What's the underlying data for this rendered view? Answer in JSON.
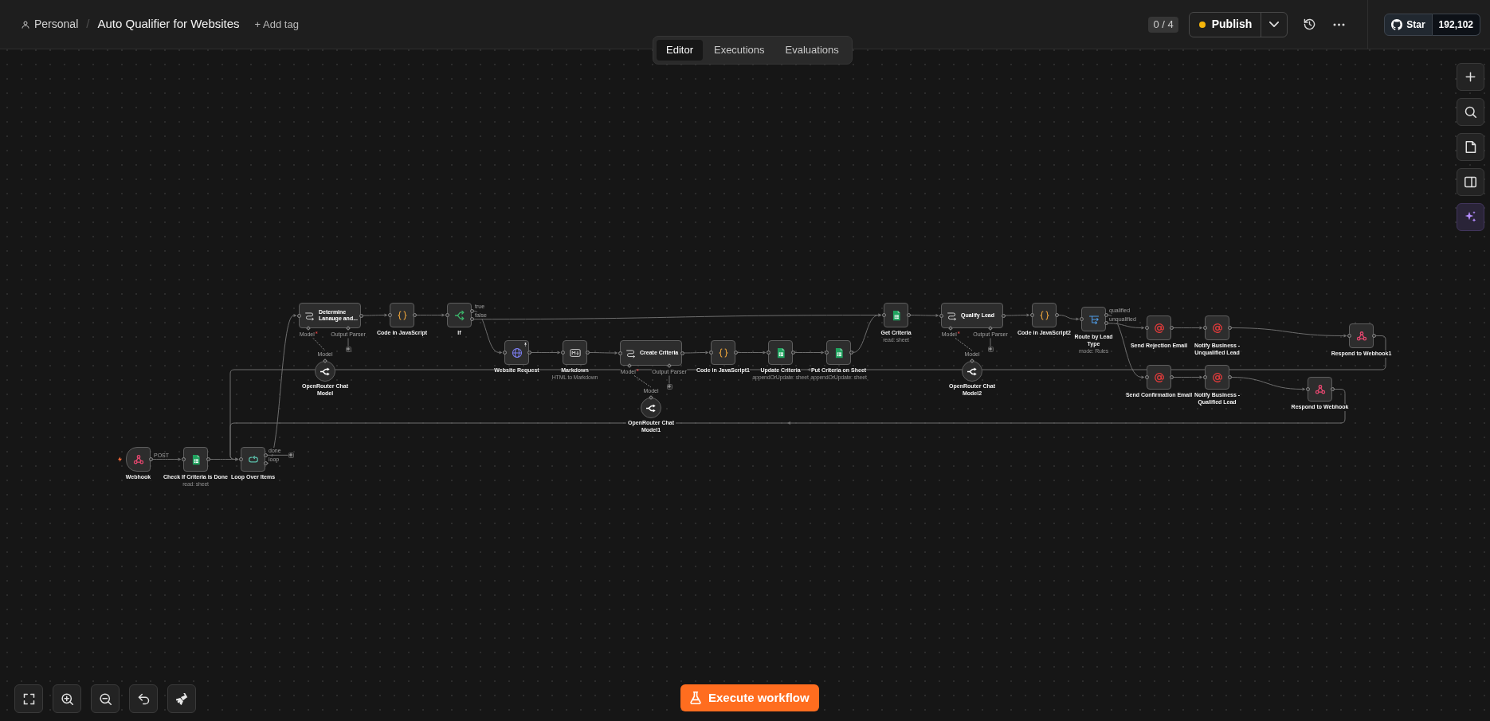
{
  "header": {
    "project": "Personal",
    "separator": "/",
    "workflow_name": "Auto Qualifier for Websites",
    "add_tag": "+ Add tag",
    "counter_badge": "0 / 4",
    "publish_button": {
      "label": "Publish",
      "pending_changes": true
    },
    "github_button": {
      "label": "Star",
      "count": "192,102"
    }
  },
  "tabs": [
    {
      "label": "Editor",
      "selected": true
    },
    {
      "label": "Executions",
      "selected": false
    },
    {
      "label": "Evaluations",
      "selected": false
    }
  ],
  "canvas": {
    "nodes": [
      {
        "kind": "webhook",
        "label": "Webhook",
        "trigger": true,
        "outputs": [
          "POST"
        ]
      },
      {
        "kind": "sheets",
        "label": "Check If Criteria is Done",
        "subtitle": "read: sheet"
      },
      {
        "kind": "loop",
        "label": "Loop Over Items",
        "outputs": [
          "done",
          "loop"
        ]
      },
      {
        "kind": "llm_chain",
        "label": "Determine Lanauge and...",
        "inputs": [
          {
            "label": "Model",
            "required": true
          },
          {
            "label": "Output Parser",
            "required": false
          }
        ]
      },
      {
        "kind": "chat_model",
        "label": "OpenRouter Chat Model",
        "output": "Model"
      },
      {
        "kind": "code",
        "label": "Code in JavaScript"
      },
      {
        "kind": "if",
        "label": "If",
        "outputs": [
          "true",
          "false"
        ]
      },
      {
        "kind": "http",
        "label": "Website Request",
        "pinned": true
      },
      {
        "kind": "markdown",
        "label": "Markdown",
        "subtitle": "HTML to Markdown"
      },
      {
        "kind": "llm_chain",
        "label": "Create Criteria",
        "inputs": [
          {
            "label": "Model",
            "required": true
          },
          {
            "label": "Output Parser",
            "required": false
          }
        ]
      },
      {
        "kind": "chat_model",
        "label": "OpenRouter Chat Model1",
        "output": "Model"
      },
      {
        "kind": "code",
        "label": "Code in JavaScript1"
      },
      {
        "kind": "sheets",
        "label": "Update Criteria",
        "subtitle": "appendOrUpdate: sheet"
      },
      {
        "kind": "sheets",
        "label": "Put Criteria on Sheet",
        "subtitle": "appendOrUpdate: sheet"
      },
      {
        "kind": "sheets",
        "label": "Get Criteria",
        "subtitle": "read: sheet"
      },
      {
        "kind": "llm_chain",
        "label": "Qualify Lead",
        "inputs": [
          {
            "label": "Model",
            "required": true
          },
          {
            "label": "Output Parser",
            "required": false
          }
        ]
      },
      {
        "kind": "chat_model",
        "label": "OpenRouter Chat Model2",
        "output": "Model"
      },
      {
        "kind": "code",
        "label": "Code in JavaScript2"
      },
      {
        "kind": "switch",
        "label": "Route by Lead Type",
        "subtitle": "mode: Rules",
        "outputs": [
          "qualified",
          "unqualified"
        ]
      },
      {
        "kind": "email",
        "label": "Send Rejection Email"
      },
      {
        "kind": "email",
        "label": "Notify Business - Unqualified Lead"
      },
      {
        "kind": "respond",
        "label": "Respond to Webhook1"
      },
      {
        "kind": "email",
        "label": "Send Confirmation Email"
      },
      {
        "kind": "email",
        "label": "Notify Business - Qualified Lead"
      },
      {
        "kind": "respond",
        "label": "Respond to Webhook"
      }
    ]
  },
  "execute_button": {
    "label": "Execute workflow"
  }
}
